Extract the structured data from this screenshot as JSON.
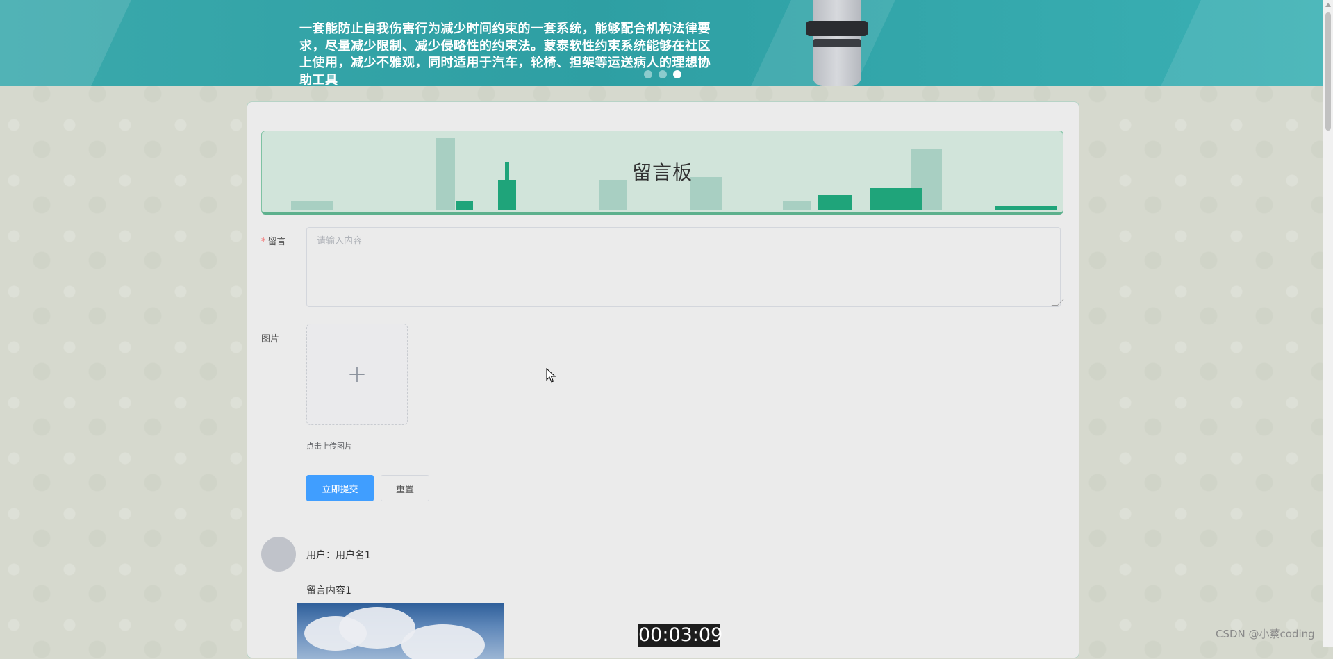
{
  "banner": {
    "text": "一套能防止自我伤害行为减少时间约束的一套系统，能够配合机构法律要求，尽量减少限制、减少侵略性的约束法。蒙泰软性约束系统能够在社区上使用，减少不雅观，同时适用于汽车，轮椅、担架等运送病人的理想协助工具",
    "carousel": {
      "slides": 3,
      "active": 3
    }
  },
  "board": {
    "title": "留言板"
  },
  "form": {
    "message_label": "留言",
    "message_placeholder": "请输入内容",
    "image_label": "图片",
    "upload_tip": "点击上传图片",
    "submit_label": "立即提交",
    "reset_label": "重置"
  },
  "comments": [
    {
      "user_line": "用户：用户名1",
      "content": "留言内容1"
    }
  ],
  "overlay": {
    "timestamp": "00:03:09",
    "watermark": "CSDN @小蔡coding"
  },
  "colors": {
    "primary": "#409eff",
    "banner": "#2e9fa3",
    "header_green": "#1fa47a",
    "required": "#f56c6c"
  }
}
